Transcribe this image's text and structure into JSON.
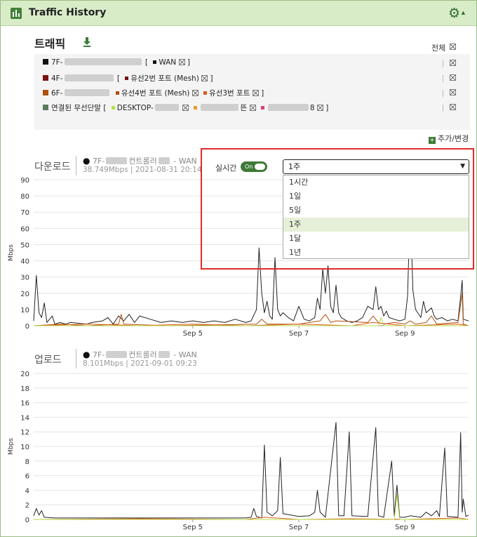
{
  "window": {
    "title": "Traffic History",
    "settings_icon": "gear-icon"
  },
  "traffic": {
    "title": "트래픽",
    "download_icon": "download-icon",
    "all_label": "전체",
    "add_change_label": "추가/변경",
    "rows": [
      {
        "color": "#111111",
        "label": "7F-",
        "group_open": "[",
        "items": [
          {
            "color": "#111111",
            "label": "WAN"
          }
        ],
        "group_close": "]"
      },
      {
        "color": "#7a1010",
        "label": "4F-",
        "group_open": "[",
        "items": [
          {
            "color": "#7a1010",
            "label": "유선2번 포트 (Mesh)"
          }
        ],
        "group_close": "]"
      },
      {
        "color": "#b0500d",
        "label": "6F-",
        "group_open": "",
        "items": [
          {
            "color": "#b0500d",
            "label": "유선4번 포트 (Mesh)"
          },
          {
            "color": "#e05a1a",
            "label": "유선3번 포트"
          }
        ],
        "group_close": "]"
      },
      {
        "color": "#5d7a5d",
        "label": "연결된 무선단말",
        "group_open": "[",
        "items": [
          {
            "color": "#b5e04a",
            "label": "DESKTOP-"
          },
          {
            "color": "#e0a030",
            "label": "뜬"
          },
          {
            "color": "#e04070",
            "label": "8"
          }
        ],
        "group_close": "]"
      }
    ]
  },
  "realtime": {
    "label": "실시간",
    "toggle": "On",
    "range_selected": "1주",
    "range_options": [
      "1시간",
      "1일",
      "5일",
      "1주",
      "1달",
      "1년"
    ]
  },
  "download": {
    "title": "다운로드",
    "device": "7F-",
    "device_suffix": "컨트롤러",
    "device_tail": "- WAN",
    "rate": "38.749Mbps | 2021-08-31 20:14"
  },
  "upload": {
    "title": "업로드",
    "device": "7F-",
    "device_suffix": "컨트롤러",
    "device_tail": "- WAN",
    "rate": "8.101Mbps | 2021-09-01 09:23"
  },
  "chart_data": [
    {
      "type": "line",
      "title": "다운로드",
      "ylabel": "Mbps",
      "ylim": [
        0,
        90
      ],
      "yticks": [
        0,
        10,
        20,
        30,
        40,
        50,
        60,
        70,
        80,
        90
      ],
      "xticks": [
        "Sep 5",
        "Sep 7",
        "Sep 9"
      ],
      "xtick_pos": [
        3.0,
        5.0,
        7.0
      ],
      "xlim": [
        0,
        8.2
      ],
      "series": [
        {
          "color": "#222222",
          "points": [
            [
              0,
              3
            ],
            [
              0.05,
              31
            ],
            [
              0.1,
              8
            ],
            [
              0.15,
              5
            ],
            [
              0.2,
              14
            ],
            [
              0.25,
              2
            ],
            [
              0.35,
              6
            ],
            [
              0.4,
              1
            ],
            [
              0.5,
              2
            ],
            [
              0.6,
              1
            ],
            [
              0.7,
              2
            ],
            [
              1.0,
              1
            ],
            [
              1.1,
              2
            ],
            [
              1.3,
              3
            ],
            [
              1.4,
              5
            ],
            [
              1.5,
              1
            ],
            [
              1.6,
              6
            ],
            [
              1.7,
              3
            ],
            [
              1.8,
              7
            ],
            [
              1.9,
              2
            ],
            [
              2.0,
              6
            ],
            [
              2.2,
              4
            ],
            [
              2.4,
              2
            ],
            [
              2.6,
              3
            ],
            [
              2.8,
              2
            ],
            [
              3.0,
              3
            ],
            [
              3.2,
              2
            ],
            [
              3.4,
              3
            ],
            [
              3.6,
              2
            ],
            [
              3.8,
              4
            ],
            [
              4.0,
              2
            ],
            [
              4.1,
              3
            ],
            [
              4.2,
              10
            ],
            [
              4.25,
              48
            ],
            [
              4.3,
              20
            ],
            [
              4.35,
              8
            ],
            [
              4.4,
              15
            ],
            [
              4.45,
              6
            ],
            [
              4.5,
              4
            ],
            [
              4.55,
              42
            ],
            [
              4.6,
              10
            ],
            [
              4.65,
              6
            ],
            [
              4.7,
              8
            ],
            [
              4.8,
              5
            ],
            [
              4.9,
              3
            ],
            [
              5.0,
              12
            ],
            [
              5.1,
              4
            ],
            [
              5.2,
              3
            ],
            [
              5.3,
              5
            ],
            [
              5.35,
              17
            ],
            [
              5.4,
              10
            ],
            [
              5.45,
              35
            ],
            [
              5.5,
              20
            ],
            [
              5.55,
              37
            ],
            [
              5.6,
              12
            ],
            [
              5.65,
              8
            ],
            [
              5.7,
              25
            ],
            [
              5.75,
              8
            ],
            [
              5.8,
              5
            ],
            [
              5.9,
              3
            ],
            [
              6.0,
              2
            ],
            [
              6.1,
              3
            ],
            [
              6.2,
              5
            ],
            [
              6.3,
              12
            ],
            [
              6.4,
              10
            ],
            [
              6.45,
              24
            ],
            [
              6.5,
              10
            ],
            [
              6.55,
              12
            ],
            [
              6.6,
              6
            ],
            [
              6.65,
              9
            ],
            [
              6.7,
              5
            ],
            [
              6.8,
              4
            ],
            [
              6.9,
              3
            ],
            [
              7.0,
              4
            ],
            [
              7.05,
              18
            ],
            [
              7.1,
              75
            ],
            [
              7.15,
              22
            ],
            [
              7.2,
              10
            ],
            [
              7.3,
              5
            ],
            [
              7.35,
              15
            ],
            [
              7.4,
              8
            ],
            [
              7.5,
              11
            ],
            [
              7.55,
              6
            ],
            [
              7.6,
              4
            ],
            [
              7.7,
              5
            ],
            [
              7.8,
              3
            ],
            [
              7.9,
              4
            ],
            [
              8.0,
              3
            ],
            [
              8.05,
              18
            ],
            [
              8.08,
              28
            ],
            [
              8.1,
              4
            ],
            [
              8.2,
              3
            ]
          ]
        },
        {
          "color": "#b0500d",
          "points": [
            [
              0,
              0
            ],
            [
              0.5,
              1
            ],
            [
              1.0,
              0
            ],
            [
              1.6,
              1
            ],
            [
              1.65,
              7
            ],
            [
              1.7,
              1
            ],
            [
              2.5,
              0
            ],
            [
              4.2,
              1
            ],
            [
              4.3,
              4
            ],
            [
              4.4,
              1
            ],
            [
              5.0,
              1
            ],
            [
              5.4,
              3
            ],
            [
              5.5,
              7
            ],
            [
              5.6,
              2
            ],
            [
              5.7,
              3
            ],
            [
              6.3,
              2
            ],
            [
              6.4,
              6
            ],
            [
              6.5,
              2
            ],
            [
              6.6,
              1
            ],
            [
              6.8,
              2
            ],
            [
              7.0,
              1
            ],
            [
              7.1,
              3
            ],
            [
              7.2,
              1
            ],
            [
              7.4,
              2
            ],
            [
              7.5,
              6
            ],
            [
              7.6,
              1
            ],
            [
              8.0,
              2
            ],
            [
              8.08,
              20
            ],
            [
              8.1,
              1
            ],
            [
              8.2,
              0
            ]
          ]
        },
        {
          "color": "#e05a1a",
          "points": [
            [
              0,
              0
            ],
            [
              1.0,
              1
            ],
            [
              2.0,
              0
            ],
            [
              3.0,
              1
            ],
            [
              4.0,
              0
            ],
            [
              5.0,
              1
            ],
            [
              6.0,
              0
            ],
            [
              6.4,
              2
            ],
            [
              7.0,
              0
            ],
            [
              8.0,
              1
            ],
            [
              8.2,
              0
            ]
          ]
        },
        {
          "color": "#b5e04a",
          "points": [
            [
              0,
              0
            ],
            [
              5.0,
              0
            ],
            [
              6.5,
              0
            ],
            [
              6.55,
              5
            ],
            [
              6.6,
              0
            ],
            [
              8.2,
              0
            ]
          ]
        }
      ]
    },
    {
      "type": "line",
      "title": "업로드",
      "ylabel": "Mbps",
      "ylim": [
        0,
        20
      ],
      "yticks": [
        0,
        2,
        4,
        6,
        8,
        10,
        12,
        14,
        16,
        18,
        20
      ],
      "xticks": [
        "Sep 5",
        "Sep 7",
        "Sep 9"
      ],
      "xtick_pos": [
        3.0,
        5.0,
        7.0
      ],
      "xlim": [
        0,
        8.2
      ],
      "series": [
        {
          "color": "#222222",
          "points": [
            [
              0,
              0.5
            ],
            [
              0.05,
              1.5
            ],
            [
              0.1,
              0.6
            ],
            [
              0.15,
              1.2
            ],
            [
              0.2,
              0.3
            ],
            [
              0.4,
              0.2
            ],
            [
              1.0,
              0.2
            ],
            [
              2.0,
              0.2
            ],
            [
              3.0,
              0.2
            ],
            [
              4.0,
              0.2
            ],
            [
              4.1,
              0.3
            ],
            [
              4.15,
              1.5
            ],
            [
              4.2,
              0.4
            ],
            [
              4.3,
              0.2
            ],
            [
              4.35,
              10.2
            ],
            [
              4.4,
              1.0
            ],
            [
              4.5,
              0.5
            ],
            [
              4.6,
              1.2
            ],
            [
              4.65,
              8.5
            ],
            [
              4.7,
              0.8
            ],
            [
              5.0,
              0.4
            ],
            [
              5.2,
              0.5
            ],
            [
              5.3,
              1.0
            ],
            [
              5.35,
              4.0
            ],
            [
              5.4,
              1.0
            ],
            [
              5.5,
              0.3
            ],
            [
              5.7,
              13.3
            ],
            [
              5.75,
              0.5
            ],
            [
              5.85,
              0.5
            ],
            [
              5.95,
              12.0
            ],
            [
              6.0,
              0.5
            ],
            [
              6.3,
              0.4
            ],
            [
              6.45,
              12.6
            ],
            [
              6.5,
              0.5
            ],
            [
              6.6,
              0.3
            ],
            [
              6.75,
              8.0
            ],
            [
              6.8,
              0.5
            ],
            [
              6.85,
              4.7
            ],
            [
              6.9,
              0.3
            ],
            [
              7.0,
              0.3
            ],
            [
              7.1,
              0.5
            ],
            [
              7.3,
              0.3
            ],
            [
              7.4,
              1.0
            ],
            [
              7.5,
              0.5
            ],
            [
              7.6,
              1.2
            ],
            [
              7.65,
              0.4
            ],
            [
              7.75,
              9.8
            ],
            [
              7.8,
              0.4
            ],
            [
              8.0,
              0.3
            ],
            [
              8.05,
              11.9
            ],
            [
              8.08,
              1.0
            ],
            [
              8.1,
              2.8
            ],
            [
              8.15,
              0.4
            ],
            [
              8.2,
              0.6
            ]
          ]
        },
        {
          "color": "#e05a1a",
          "points": [
            [
              0,
              0
            ],
            [
              2.0,
              0.1
            ],
            [
              4.0,
              0
            ],
            [
              4.35,
              0.3
            ],
            [
              5.0,
              0
            ],
            [
              6.0,
              0.1
            ],
            [
              7.0,
              0
            ],
            [
              8.0,
              0.2
            ],
            [
              8.2,
              0
            ]
          ]
        },
        {
          "color": "#b5e04a",
          "points": [
            [
              0,
              0
            ],
            [
              6.8,
              0
            ],
            [
              6.85,
              3.5
            ],
            [
              6.9,
              0
            ],
            [
              8.2,
              0
            ]
          ]
        }
      ]
    }
  ]
}
